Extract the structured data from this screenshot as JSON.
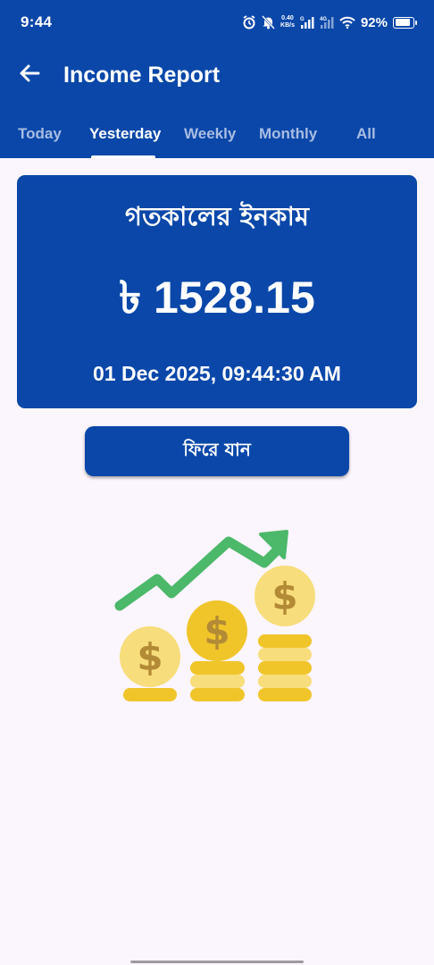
{
  "status_bar": {
    "time": "9:44",
    "net_speed_value": "0.40",
    "net_speed_unit": "KB/s",
    "battery_percent": "92%",
    "battery_level": 0.92,
    "icons": [
      "alarm-icon",
      "mute-icon",
      "signal-icon",
      "4g-signal-icon",
      "wifi-icon",
      "battery-icon"
    ]
  },
  "header": {
    "title": "Income Report",
    "back_icon": "arrow-left-icon"
  },
  "tabs": [
    {
      "label": "Today",
      "active": false
    },
    {
      "label": "Yesterday",
      "active": true
    },
    {
      "label": "Weekly",
      "active": false
    },
    {
      "label": "Monthly",
      "active": false
    },
    {
      "label": "All",
      "active": false
    }
  ],
  "summary": {
    "title": "গতকালের ইনকাম",
    "amount": "৳ 1528.15",
    "datetime": "01 Dec 2025, 09:44:30 AM"
  },
  "back_button_label": "ফিরে যান",
  "illustration": "income-growth-coins-icon",
  "colors": {
    "primary": "#0a47a9",
    "background": "#fbf5fd",
    "tab_inactive": "#a9bde2",
    "arrow_green": "#4cb86a",
    "coin_gold": "#f0c52a",
    "coin_light": "#f7dd7b",
    "dollar_brown": "#b38a35"
  }
}
